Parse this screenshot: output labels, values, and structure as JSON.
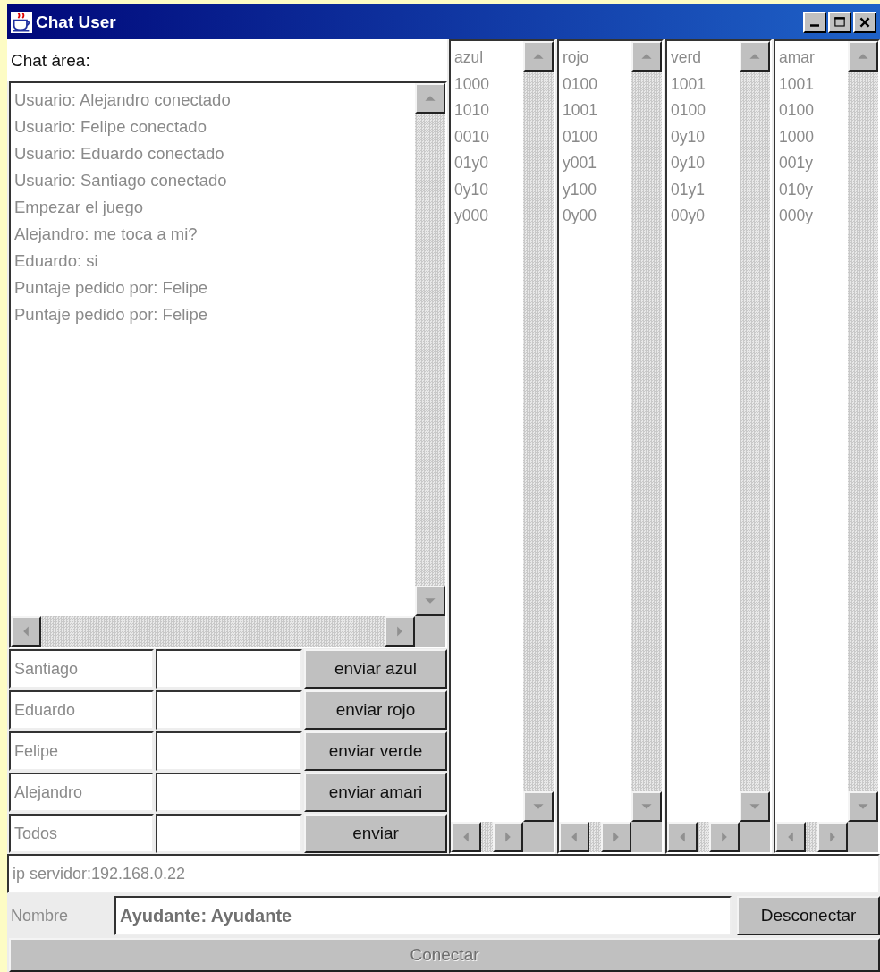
{
  "window": {
    "title": "Chat User"
  },
  "chat": {
    "label": "Chat área:",
    "messages": [
      "Usuario: Alejandro conectado",
      "Usuario: Felipe conectado",
      "Usuario: Eduardo conectado",
      "Usuario: Santiago conectado",
      "Empezar el juego",
      "Alejandro: me toca a mi?",
      "Eduardo: si",
      "Puntaje pedido por: Felipe",
      "Puntaje pedido por: Felipe"
    ]
  },
  "send_rows": [
    {
      "name": "Santiago",
      "button": "enviar azul"
    },
    {
      "name": "Eduardo",
      "button": "enviar rojo"
    },
    {
      "name": "Felipe",
      "button": "enviar verde"
    },
    {
      "name": "Alejandro",
      "button": "enviar amari"
    },
    {
      "name": "Todos",
      "button": "enviar"
    }
  ],
  "color_lists": [
    {
      "header": "azul",
      "values": [
        "1000",
        "1010",
        "0010",
        "01y0",
        "0y10",
        "y000"
      ]
    },
    {
      "header": "rojo",
      "values": [
        "0100",
        "1001",
        "0100",
        "y001",
        "y100",
        "0y00"
      ]
    },
    {
      "header": "verd",
      "values": [
        "1001",
        "0100",
        "0y10",
        "0y10",
        "01y1",
        "00y0"
      ]
    },
    {
      "header": "amar",
      "values": [
        "1001",
        "0100",
        "1000",
        "001y",
        "010y",
        "000y"
      ]
    }
  ],
  "server_field": {
    "value": "ip servidor:192.168.0.22"
  },
  "name_row": {
    "label": "Nombre",
    "value": "Ayudante: Ayudante",
    "button": "Desconectar"
  },
  "connect_button": {
    "label": "Conectar",
    "disabled": true
  }
}
